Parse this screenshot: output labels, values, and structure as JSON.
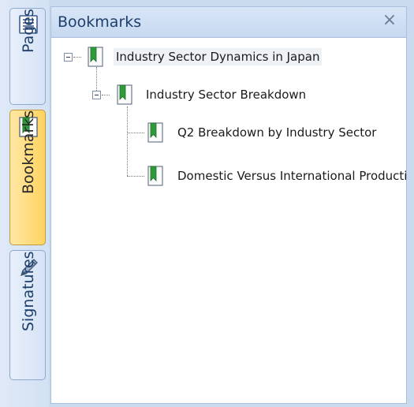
{
  "tabs": {
    "pages": "Pages",
    "bookmarks": "Bookmarks",
    "signatures": "Signatures"
  },
  "panel": {
    "title": "Bookmarks",
    "close_glyph": "×"
  },
  "tree": {
    "root": {
      "label": "Industry Sector Dynamics in Japan",
      "expanded": true,
      "selected": true
    },
    "child": {
      "label": "Industry Sector Breakdown",
      "expanded": true
    },
    "leaves": [
      {
        "label": "Q2 Breakdown by Industry Sector"
      },
      {
        "label": "Domestic Versus International Production"
      }
    ]
  },
  "colors": {
    "active_tab": "#ffd35f",
    "bookmark_green": "#2f9a3a",
    "title_blue": "#1e3e6c"
  },
  "icons": [
    "pages-icon",
    "bookmark-icon",
    "pen-icon",
    "close-icon"
  ]
}
